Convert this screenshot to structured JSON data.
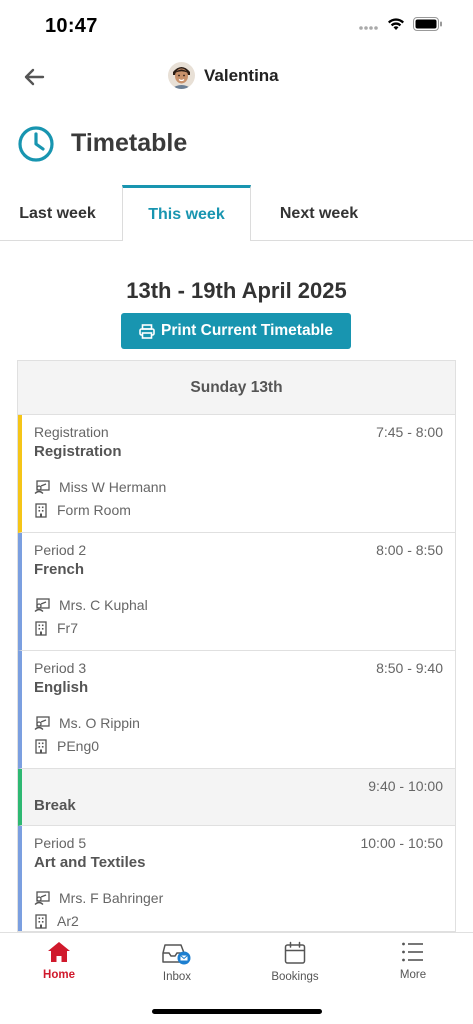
{
  "status_bar": {
    "time": "10:47"
  },
  "nav": {
    "user_name": "Valentina"
  },
  "page": {
    "title": "Timetable"
  },
  "tabs": [
    {
      "label": "Last week",
      "active": false
    },
    {
      "label": "This week",
      "active": true
    },
    {
      "label": "Next week",
      "active": false
    }
  ],
  "week_range": "13th - 19th April 2025",
  "print_button_label": "Print Current Timetable",
  "day": {
    "label": "Sunday 13th",
    "lessons": [
      {
        "period": "Registration",
        "time": "7:45 - 8:00",
        "subject": "Registration",
        "teacher": "Miss W Hermann",
        "room": "Form Room",
        "color": "#f5c518"
      },
      {
        "period": "Period 2",
        "time": "8:00 - 8:50",
        "subject": "French",
        "teacher": "Mrs. C Kuphal",
        "room": "Fr7",
        "color": "#7b9fe0"
      },
      {
        "period": "Period 3",
        "time": "8:50 - 9:40",
        "subject": "English",
        "teacher": "Ms. O Rippin",
        "room": "PEng0",
        "color": "#7b9fe0"
      },
      {
        "period": "",
        "time": "9:40 - 10:00",
        "subject": "Break",
        "teacher": "",
        "room": "",
        "color": "#2eb872"
      },
      {
        "period": "Period 5",
        "time": "10:00 - 10:50",
        "subject": "Art and Textiles",
        "teacher": "Mrs. F Bahringer",
        "room": "Ar2",
        "color": "#7b9fe0"
      }
    ]
  },
  "bottom_nav": [
    {
      "label": "Home",
      "icon": "home-icon",
      "active": true
    },
    {
      "label": "Inbox",
      "icon": "inbox-icon",
      "active": false
    },
    {
      "label": "Bookings",
      "icon": "calendar-icon",
      "active": false
    },
    {
      "label": "More",
      "icon": "menu-icon",
      "active": false
    }
  ],
  "colors": {
    "accent": "#1895b0",
    "active_nav": "#d0192c"
  }
}
